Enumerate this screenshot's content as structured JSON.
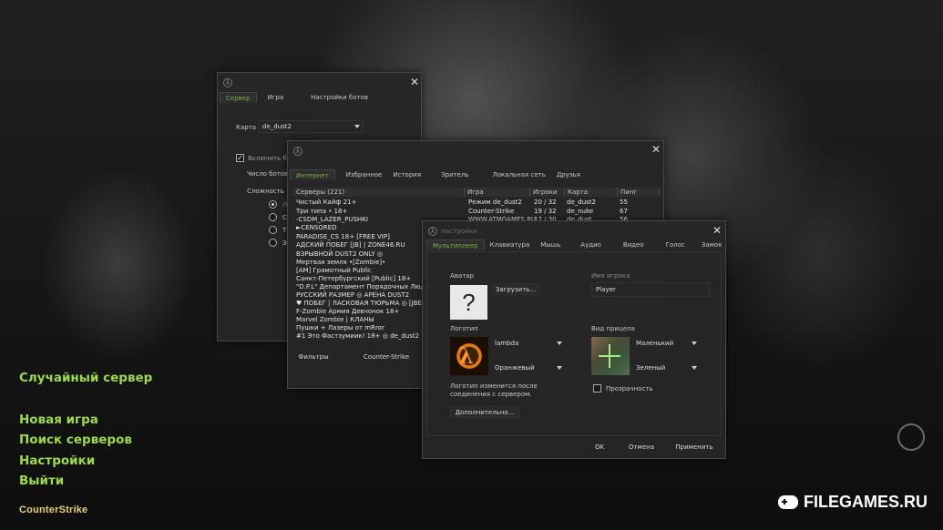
{
  "main_menu": {
    "random_server": "Случайный сервер",
    "new_game": "Новая игра",
    "find_servers": "Поиск серверов",
    "settings": "Настройки",
    "quit": "Выйти"
  },
  "game_logo": "CounterStrike",
  "watermark": "FILEGAMES.RU",
  "create_dialog": {
    "tabs": [
      "Сервер",
      "Игра",
      "Настройки ботов"
    ],
    "map_label": "Карта",
    "map_value": "de_dust2",
    "enable_bots_label": "Включить бот",
    "enable_bots_checked": true,
    "bot_count_label": "Число ботов",
    "difficulty_label": "Сложность",
    "difficulty_options": [
      "Л",
      "Ср",
      "Т",
      "Эк"
    ]
  },
  "servers_dialog": {
    "tabs": [
      "Интернет",
      "Избранное",
      "История",
      "Зритель",
      "Локальная сеть",
      "Друзья"
    ],
    "columns": [
      "Серверы (221)",
      "Игра",
      "Игроки",
      "Карта",
      "Пинг"
    ],
    "rows": [
      {
        "name": "Чистый Кайф 21+",
        "game": "Режим de_dust2",
        "players": "20 / 32",
        "map": "de_dust2",
        "ping": "55"
      },
      {
        "name": "Три типа • 18+",
        "game": "Counter-Strike",
        "players": "19 / 32",
        "map": "de_nuke",
        "ping": "67"
      },
      {
        "name": "-CSDM_LAZER_PUSHKI",
        "game": "WWW.ATMGAMES.RU",
        "players": "17 / 30",
        "map": "de_dust",
        "ping": "56"
      },
      {
        "name": "►CENSORED",
        "game": "",
        "players": "",
        "map": "",
        "ping": ""
      }
    ],
    "more_servers": [
      "PARADISE_CS 18+ [FREE VIP]",
      "АДСКИЙ ПОБЕГ [JB] | ZONE46.RU",
      "ВЗРЫВНОЙ DUST2 ONLY ◎",
      "Мертвая земля •[Zombie]•",
      "[AM] Грамотный Public",
      "Санкт-Петербургский [Public] 18+",
      "\"D.P.L\" Департамент Порядочных Люд�",
      "РУССКИЙ РАЗМЕР ◎ АРЕНА DUST2",
      "♥ ПОБЕГ | ЛАСКОВАЯ ТЮРЬМА ◎ [JBE]",
      "F-Zombie Армия Девчонок 18+",
      "Marvel Zombie | КЛАНЫ",
      "Пушки + Лазеры от mRror",
      "#1 Это Фастзумиик! 18+ ◎ de_dust2"
    ],
    "filters_button": "Фильтры",
    "game_filter": "Counter-Strike"
  },
  "settings_dialog": {
    "title": "Настройки",
    "tabs": [
      "Мультиплеер",
      "Клавиатура",
      "Мышь",
      "Аудио",
      "Видео",
      "Голос",
      "Замок"
    ],
    "avatar_label": "Аватар",
    "avatar_placeholder": "?",
    "load_button": "Загрузить...",
    "player_name_label": "Имя игрока",
    "player_name_value": "Player",
    "logo_label": "Логотип",
    "logo_value": "lambda",
    "logo_color": "Оранжевый",
    "logo_note": "Логотип изменится после соединения с сервером.",
    "advanced_button": "Дополнительно...",
    "crosshair_label": "Вид прицела",
    "crosshair_size": "Маленький",
    "crosshair_color": "Зеленый",
    "transparency_label": "Прозрачность",
    "ok_button": "OK",
    "cancel_button": "Отмена",
    "apply_button": "Применить"
  },
  "colors": {
    "menu_green": "#9cdc3c",
    "active_tab": "#74b23a"
  }
}
